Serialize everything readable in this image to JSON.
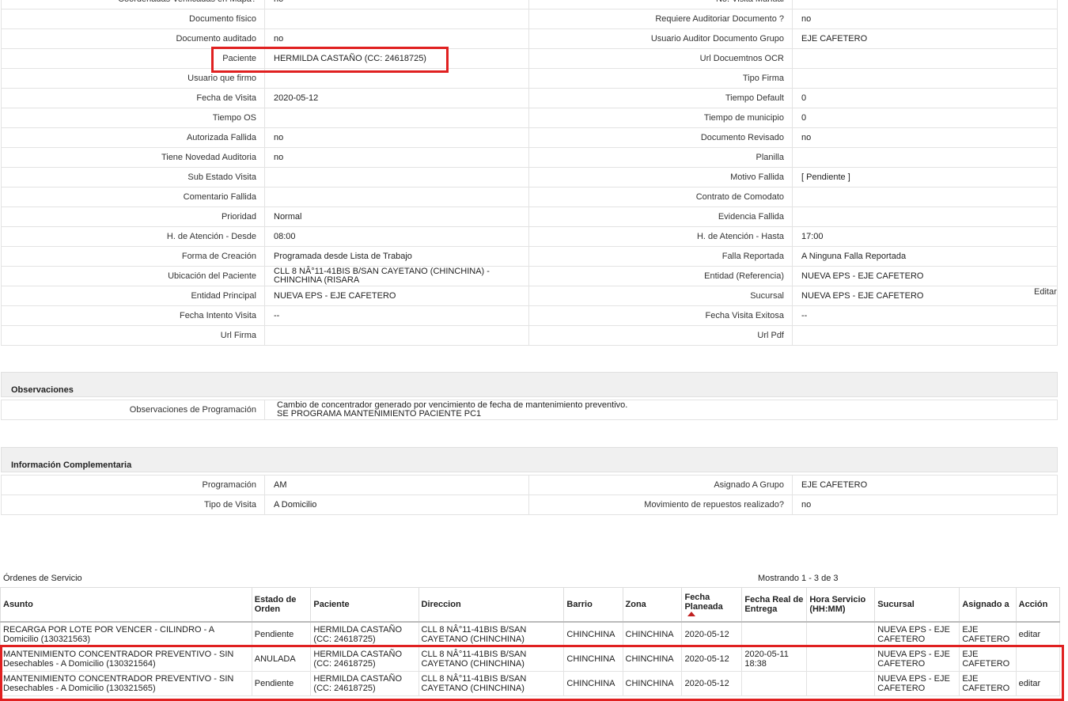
{
  "details": {
    "rows": [
      {
        "l1": "Coordenadas Verificadas en Mapa?",
        "v1": "no",
        "l2": "No. Visita Manual",
        "v2": ""
      },
      {
        "l1": "Documento físico",
        "v1": "",
        "l2": "Requiere Auditoriar Documento ?",
        "v2": "no"
      },
      {
        "l1": "Documento auditado",
        "v1": "no",
        "l2": "Usuario Auditor Documento Grupo",
        "v2": "EJE CAFETERO"
      },
      {
        "l1": "Paciente",
        "v1": "HERMILDA CASTAÑO (CC: 24618725)",
        "l2": "Url Docuemtnos OCR",
        "v2": ""
      },
      {
        "l1": "Usuario que firmo",
        "v1": "",
        "l2": "Tipo Firma",
        "v2": ""
      },
      {
        "l1": "Fecha de Visita",
        "v1": "2020-05-12",
        "l2": "Tiempo Default",
        "v2": "0"
      },
      {
        "l1": "Tiempo OS",
        "v1": "",
        "l2": "Tiempo de municipio",
        "v2": "0"
      },
      {
        "l1": "Autorizada Fallida",
        "v1": "no",
        "l2": "Documento Revisado",
        "v2": "no"
      },
      {
        "l1": "Tiene Novedad Auditoria",
        "v1": "no",
        "l2": "Planilla",
        "v2": ""
      },
      {
        "l1": "Sub Estado Visita",
        "v1": "",
        "l2": "Motivo Fallida",
        "v2": "[ Pendiente ]"
      },
      {
        "l1": "Comentario Fallida",
        "v1": "",
        "l2": "Contrato de Comodato",
        "v2": ""
      },
      {
        "l1": "Prioridad",
        "v1": "Normal",
        "l2": "Evidencia Fallida",
        "v2": ""
      },
      {
        "l1": "H. de Atención - Desde",
        "v1": "08:00",
        "l2": "H. de Atención - Hasta",
        "v2": "17:00"
      },
      {
        "l1": "Forma de Creación",
        "v1": "Programada desde Lista de Trabajo",
        "l2": "Falla Reportada",
        "v2": "A Ninguna Falla Reportada"
      },
      {
        "l1": "Ubicación del Paciente",
        "v1": "CLL 8 NÂ°11-41BIS B/SAN CAYETANO (CHINCHINA) - CHINCHINA (RISARA",
        "l2": "Entidad (Referencia)",
        "v2": "NUEVA EPS - EJE CAFETERO"
      },
      {
        "l1": "Entidad Principal",
        "v1": "NUEVA EPS - EJE CAFETERO",
        "l2": "Sucursal",
        "v2": "NUEVA EPS - EJE CAFETERO"
      },
      {
        "l1": "Fecha Intento Visita",
        "v1": "--",
        "l2": "Fecha Visita Exitosa",
        "v2": "--"
      },
      {
        "l1": "Url Firma",
        "v1": "",
        "l2": "Url Pdf",
        "v2": ""
      }
    ],
    "edit_label": "Editar"
  },
  "observaciones": {
    "title": "Observaciones",
    "label": "Observaciones de Programación",
    "line1": "Cambio de concentrador generado por vencimiento de fecha de mantenimiento preventivo.",
    "line2": "SE PROGRAMA MANTENIMIENTO PACIENTE PC1"
  },
  "complementaria": {
    "title": "Información Complementaria",
    "rows": [
      {
        "l1": "Programación",
        "v1": "AM",
        "l2": "Asignado A Grupo",
        "v2": "EJE CAFETERO"
      },
      {
        "l1": "Tipo de Visita",
        "v1": "A Domicilio",
        "l2": "Movimiento de repuestos realizado?",
        "v2": "no"
      }
    ]
  },
  "orders": {
    "title": "Órdenes de Servicio",
    "count": "Mostrando 1 - 3 de 3",
    "headers": [
      "Asunto",
      "Estado de Orden",
      "Paciente",
      "Direccion",
      "Barrio",
      "Zona",
      "Fecha Planeada",
      "Fecha Real de Entrega",
      "Hora Servicio (HH:MM)",
      "Sucursal",
      "Asignado a",
      "Acción"
    ],
    "rows": [
      {
        "asunto": "RECARGA POR LOTE POR VENCER - CILINDRO - A Domicilio (130321563)",
        "estado": "Pendiente",
        "paciente": "HERMILDA CASTAÑO (CC: 24618725)",
        "direccion": "CLL 8 NÂ°11-41BIS B/SAN CAYETANO (CHINCHINA)",
        "barrio": "CHINCHINA",
        "zona": "CHINCHINA",
        "fecha_planeada": "2020-05-12",
        "fecha_real": "",
        "hora": "",
        "sucursal": "NUEVA EPS - EJE CAFETERO",
        "asignado": "EJE CAFETERO",
        "accion": "editar"
      },
      {
        "asunto": "MANTENIMIENTO CONCENTRADOR PREVENTIVO - SIN Desechables - A Domicilio (130321564)",
        "estado": "ANULADA",
        "paciente": "HERMILDA CASTAÑO (CC: 24618725)",
        "direccion": "CLL 8 NÂ°11-41BIS B/SAN CAYETANO (CHINCHINA)",
        "barrio": "CHINCHINA",
        "zona": "CHINCHINA",
        "fecha_planeada": "2020-05-12",
        "fecha_real": "2020-05-11 18:38",
        "hora": "",
        "sucursal": "NUEVA EPS - EJE CAFETERO",
        "asignado": "EJE CAFETERO",
        "accion": ""
      },
      {
        "asunto": "MANTENIMIENTO CONCENTRADOR PREVENTIVO - SIN Desechables - A Domicilio (130321565)",
        "estado": "Pendiente",
        "paciente": "HERMILDA CASTAÑO (CC: 24618725)",
        "direccion": "CLL 8 NÂ°11-41BIS B/SAN CAYETANO (CHINCHINA)",
        "barrio": "CHINCHINA",
        "zona": "CHINCHINA",
        "fecha_planeada": "2020-05-12",
        "fecha_real": "",
        "hora": "",
        "sucursal": "NUEVA EPS - EJE CAFETERO",
        "asignado": "EJE CAFETERO",
        "accion": "editar"
      }
    ]
  },
  "colors": {
    "highlight": "#e02020",
    "header_bg": "#f0f0f0"
  }
}
